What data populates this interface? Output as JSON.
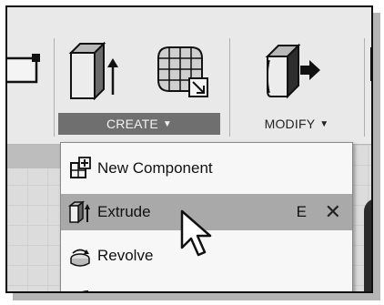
{
  "toolbar": {
    "create_label": "CREATE",
    "modify_label": "MODIFY",
    "dropdown_caret": "▼"
  },
  "menu": {
    "items": [
      {
        "label": "New Component",
        "icon": "new-component-icon"
      },
      {
        "label": "Extrude",
        "icon": "extrude-icon",
        "shortcut": "E",
        "highlighted": true
      },
      {
        "label": "Revolve",
        "icon": "revolve-icon"
      }
    ],
    "close_glyph": "✕"
  },
  "colors": {
    "toolbar_bg": "#e9e9e9",
    "active_group_bg": "#6f6f6f",
    "menu_highlight": "#a9a9a9"
  }
}
